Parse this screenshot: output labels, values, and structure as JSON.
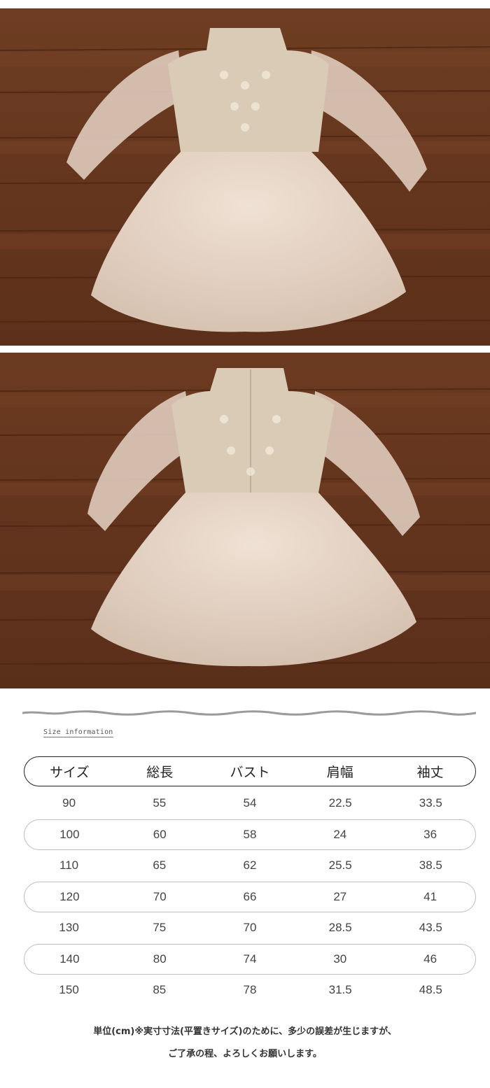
{
  "images": [
    {
      "name": "dress-front-photo",
      "alt": "lace tulle dress front"
    },
    {
      "name": "dress-back-photo",
      "alt": "lace tulle dress back"
    }
  ],
  "size_info_label": "Size information",
  "table": {
    "headers": [
      "サイズ",
      "総長",
      "バスト",
      "肩幅",
      "袖丈"
    ],
    "rows": [
      [
        "90",
        "55",
        "54",
        "22.5",
        "33.5"
      ],
      [
        "100",
        "60",
        "58",
        "24",
        "36"
      ],
      [
        "110",
        "65",
        "62",
        "25.5",
        "38.5"
      ],
      [
        "120",
        "70",
        "66",
        "27",
        "41"
      ],
      [
        "130",
        "75",
        "70",
        "28.5",
        "43.5"
      ],
      [
        "140",
        "80",
        "74",
        "30",
        "46"
      ],
      [
        "150",
        "85",
        "78",
        "31.5",
        "48.5"
      ]
    ]
  },
  "notes": [
    "単位(cm)※実寸寸法(平置きサイズ)のために、多少の誤差が生じますが、",
    "ご了承の程、よろしくお願いします。"
  ],
  "colors": {
    "wood": "#6a3a22",
    "dress": "#e7d5c6",
    "lace": "#d9cbb6"
  }
}
